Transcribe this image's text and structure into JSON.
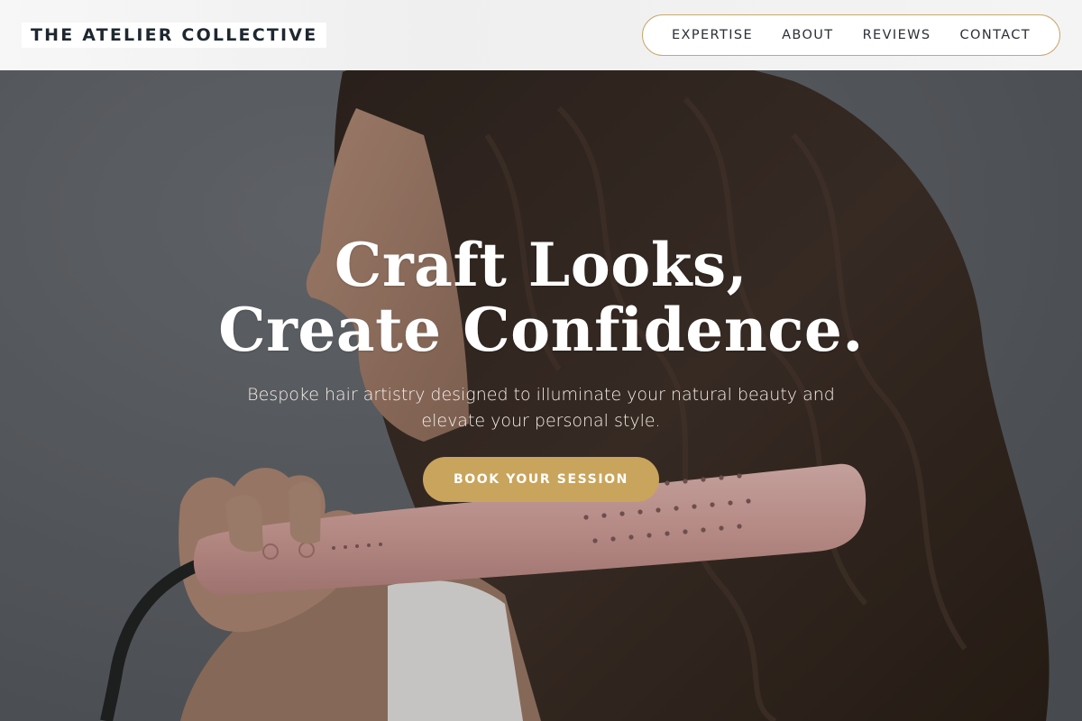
{
  "header": {
    "brand": "THE ATELIER COLLECTIVE",
    "nav": [
      {
        "label": "EXPERTISE"
      },
      {
        "label": "ABOUT"
      },
      {
        "label": "REVIEWS"
      },
      {
        "label": "CONTACT"
      }
    ]
  },
  "hero": {
    "headline_line1": "Craft Looks,",
    "headline_line2": "Create Confidence.",
    "subtitle": "Bespoke hair artistry designed to illuminate your natural beauty and elevate your personal style.",
    "cta_label": "BOOK YOUR SESSION",
    "image": "woman-with-long-wavy-hair-holding-pink-hair-styler"
  },
  "colors": {
    "accent_gold": "#c9a45c",
    "nav_border": "#c9a86a",
    "brand_text": "#1f2730",
    "hero_background": "#5a5d62"
  }
}
